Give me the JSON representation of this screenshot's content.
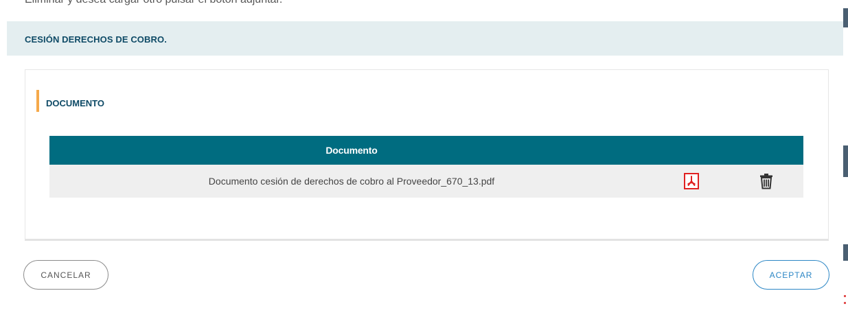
{
  "top_partial_text": "Eliminar y desea cargar otro pulsar el botón adjuntar.",
  "modal": {
    "title": "CESIÓN DERECHOS DE COBRO."
  },
  "section": {
    "title": "DOCUMENTO"
  },
  "table": {
    "header": "Documento",
    "rows": [
      {
        "name": "Documento cesión de derechos de cobro al Proveedor_670_13.pdf"
      }
    ]
  },
  "buttons": {
    "cancel": "CANCELAR",
    "accept": "ACEPTAR"
  },
  "icons": {
    "pdf": "pdf-icon",
    "delete": "trash-icon"
  },
  "colors": {
    "header_bg": "#e4eef0",
    "title_text": "#0e4a66",
    "accent_bar": "#f5a94a",
    "table_header": "#006c80",
    "row_bg": "#efefef",
    "pdf_red": "#e02020",
    "accept_blue": "#2b86c5"
  }
}
